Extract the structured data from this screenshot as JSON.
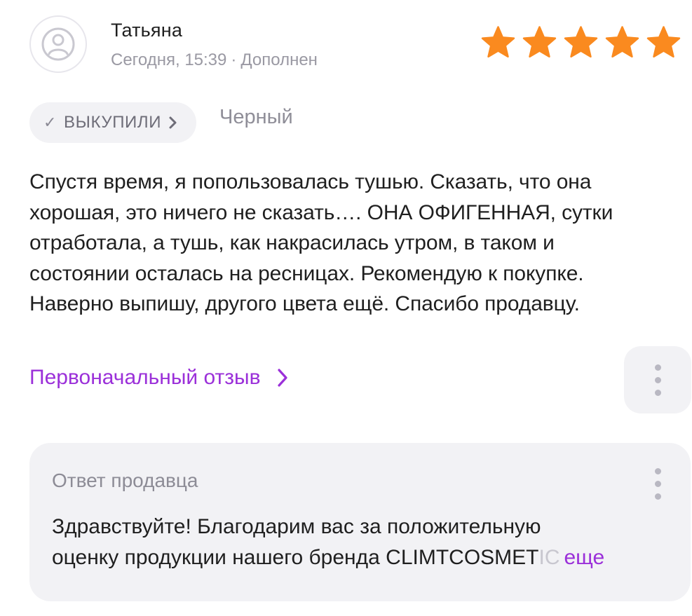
{
  "review": {
    "author": "Татьяна",
    "date": "Сегодня, 15:39",
    "separator": "·",
    "status": "Дополнен",
    "rating": 5,
    "rating_color": "#fa8a1f",
    "bought_chip": {
      "check": "✓",
      "label": "ВЫКУПИЛИ"
    },
    "color_variant": "Черный",
    "text_lines": [
      "Спустя время, я попользовалась тушью. Сказать, что она",
      "хорошая, это ничего не сказать…. ОНА ОФИГЕННАЯ, сутки",
      "отработала, а тушь, как накрасилась утром, в таком и",
      "состоянии осталась на ресницах. Рекомендую к покупке.",
      "Наверно выпишу, другого цвета ещё. Спасибо продавцу."
    ],
    "original_review_link": "Первоначальный отзыв",
    "accent_color": "#9b30d9"
  },
  "seller_reply": {
    "title": "Ответ продавца",
    "line1": "Здравствуйте! Благодарим вас за положительную",
    "line2_main": "оценку продукции нашего бренда CLIMTCOSMET",
    "line2_fade": "IC",
    "more_label": "еще"
  },
  "icons": {
    "avatar": "user-avatar-icon",
    "star": "star-icon",
    "chevron": "chevron-right-icon",
    "more": "more-vertical-icon"
  }
}
